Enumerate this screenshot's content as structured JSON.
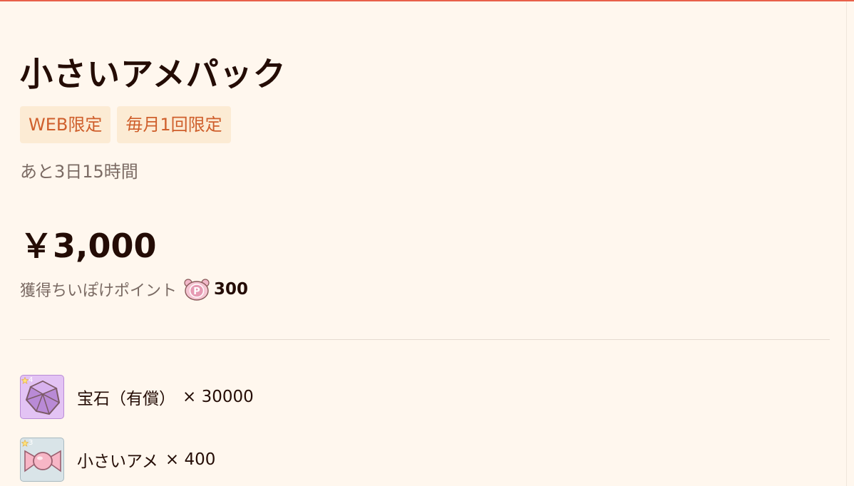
{
  "product": {
    "title": "小さいアメパック",
    "badges": [
      "WEB限定",
      "毎月1回限定"
    ],
    "remaining": "あと3日15時間",
    "price": "￥3,000",
    "points_label": "獲得ちいぽけポイント",
    "points_icon": "p-point-coin-icon",
    "points_value": "300"
  },
  "items": [
    {
      "name": "宝石（有償）",
      "qty": "× 30000",
      "rarity": "4",
      "icon": "gem-icon"
    },
    {
      "name": "小さいアメ",
      "qty": "× 400",
      "rarity": "3",
      "icon": "candy-icon"
    }
  ],
  "colors": {
    "background": "#fff7ee",
    "accent_border": "#e8604a",
    "badge_bg": "#fcebd4",
    "badge_text": "#cf5f2c",
    "title_text": "#240c05",
    "muted_text": "#7a6a63"
  }
}
